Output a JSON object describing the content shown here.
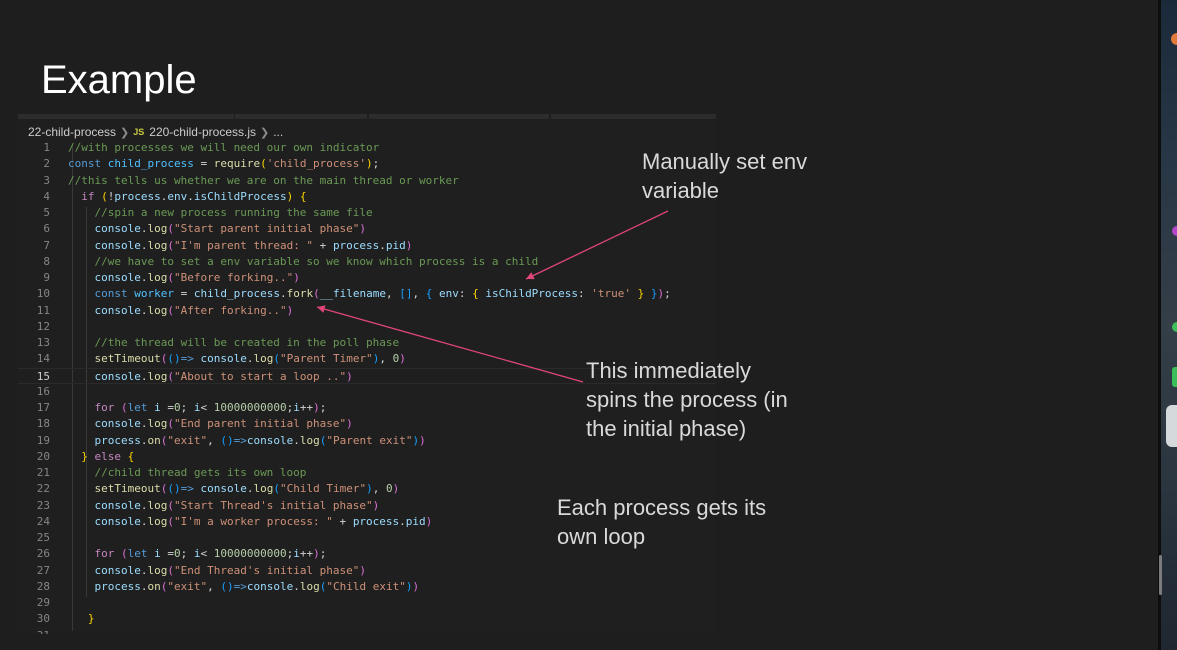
{
  "slide": {
    "title": "Example"
  },
  "breadcrumb": {
    "folder": "22-child-process",
    "file_icon": "JS",
    "file": "220-child-process.js",
    "more": "..."
  },
  "code": {
    "lines": [
      {
        "n": "1",
        "tokens": [
          [
            "com",
            "//with processes we will need our own indicator"
          ]
        ]
      },
      {
        "n": "2",
        "tokens": [
          [
            "kw",
            "const "
          ],
          [
            "const",
            "child_process"
          ],
          [
            "plain",
            " = "
          ],
          [
            "fn",
            "require"
          ],
          [
            "b1",
            "("
          ],
          [
            "str",
            "'child_process'"
          ],
          [
            "b1",
            ")"
          ],
          [
            "plain",
            ";"
          ]
        ]
      },
      {
        "n": "3",
        "tokens": [
          [
            "com",
            "//this tells us whether we are on the main thread or worker"
          ]
        ]
      },
      {
        "n": "4",
        "tokens": [
          [
            "plain",
            "  "
          ],
          [
            "ctl",
            "if "
          ],
          [
            "b1",
            "("
          ],
          [
            "plain",
            "!"
          ],
          [
            "var",
            "process"
          ],
          [
            "plain",
            "."
          ],
          [
            "var",
            "env"
          ],
          [
            "plain",
            "."
          ],
          [
            "var",
            "isChildProcess"
          ],
          [
            "b1",
            ")"
          ],
          [
            "plain",
            " "
          ],
          [
            "b1",
            "{"
          ]
        ]
      },
      {
        "n": "5",
        "tokens": [
          [
            "plain",
            "    "
          ],
          [
            "com",
            "//spin a new process running the same file"
          ]
        ]
      },
      {
        "n": "6",
        "tokens": [
          [
            "plain",
            "    "
          ],
          [
            "var",
            "console"
          ],
          [
            "plain",
            "."
          ],
          [
            "fn",
            "log"
          ],
          [
            "b2",
            "("
          ],
          [
            "str",
            "\"Start parent initial phase\""
          ],
          [
            "b2",
            ")"
          ]
        ]
      },
      {
        "n": "7",
        "tokens": [
          [
            "plain",
            "    "
          ],
          [
            "var",
            "console"
          ],
          [
            "plain",
            "."
          ],
          [
            "fn",
            "log"
          ],
          [
            "b2",
            "("
          ],
          [
            "str",
            "\"I'm parent thread: \""
          ],
          [
            "plain",
            " + "
          ],
          [
            "var",
            "process"
          ],
          [
            "plain",
            "."
          ],
          [
            "var",
            "pid"
          ],
          [
            "b2",
            ")"
          ]
        ]
      },
      {
        "n": "8",
        "tokens": [
          [
            "plain",
            "    "
          ],
          [
            "com",
            "//we have to set a env variable so we know which process is a child"
          ]
        ]
      },
      {
        "n": "9",
        "tokens": [
          [
            "plain",
            "    "
          ],
          [
            "var",
            "console"
          ],
          [
            "plain",
            "."
          ],
          [
            "fn",
            "log"
          ],
          [
            "b2",
            "("
          ],
          [
            "str",
            "\"Before forking..\""
          ],
          [
            "b2",
            ")"
          ]
        ]
      },
      {
        "n": "10",
        "tokens": [
          [
            "plain",
            "    "
          ],
          [
            "kw",
            "const "
          ],
          [
            "const",
            "worker"
          ],
          [
            "plain",
            " = "
          ],
          [
            "var",
            "child_process"
          ],
          [
            "plain",
            "."
          ],
          [
            "fn",
            "fork"
          ],
          [
            "b2",
            "("
          ],
          [
            "var",
            "__filename"
          ],
          [
            "plain",
            ", "
          ],
          [
            "b3",
            "[]"
          ],
          [
            "plain",
            ", "
          ],
          [
            "b3",
            "{"
          ],
          [
            "plain",
            " "
          ],
          [
            "var",
            "env"
          ],
          [
            "plain",
            ": "
          ],
          [
            "b1",
            "{"
          ],
          [
            "plain",
            " "
          ],
          [
            "var",
            "isChildProcess"
          ],
          [
            "plain",
            ": "
          ],
          [
            "str",
            "'true'"
          ],
          [
            "plain",
            " "
          ],
          [
            "b1",
            "}"
          ],
          [
            "plain",
            " "
          ],
          [
            "b3",
            "}"
          ],
          [
            "b2",
            ")"
          ],
          [
            "plain",
            ";"
          ]
        ]
      },
      {
        "n": "11",
        "tokens": [
          [
            "plain",
            "    "
          ],
          [
            "var",
            "console"
          ],
          [
            "plain",
            "."
          ],
          [
            "fn",
            "log"
          ],
          [
            "b2",
            "("
          ],
          [
            "str",
            "\"After forking..\""
          ],
          [
            "b2",
            ")"
          ]
        ]
      },
      {
        "n": "12",
        "tokens": []
      },
      {
        "n": "13",
        "tokens": [
          [
            "plain",
            "    "
          ],
          [
            "com",
            "//the thread will be created in the poll phase"
          ]
        ]
      },
      {
        "n": "14",
        "tokens": [
          [
            "plain",
            "    "
          ],
          [
            "fn",
            "setTimeout"
          ],
          [
            "b2",
            "("
          ],
          [
            "b3",
            "()"
          ],
          [
            "arrow",
            "=>"
          ],
          [
            "plain",
            " "
          ],
          [
            "var",
            "console"
          ],
          [
            "plain",
            "."
          ],
          [
            "fn",
            "log"
          ],
          [
            "b3",
            "("
          ],
          [
            "str",
            "\"Parent Timer\""
          ],
          [
            "b3",
            ")"
          ],
          [
            "plain",
            ", "
          ],
          [
            "num",
            "0"
          ],
          [
            "b2",
            ")"
          ]
        ]
      },
      {
        "n": "15",
        "tokens": [
          [
            "plain",
            "    "
          ],
          [
            "var",
            "console"
          ],
          [
            "plain",
            "."
          ],
          [
            "fn",
            "log"
          ],
          [
            "b2",
            "("
          ],
          [
            "str",
            "\"About to start a loop ..\""
          ],
          [
            "b2",
            ")"
          ]
        ]
      },
      {
        "n": "16",
        "tokens": []
      },
      {
        "n": "17",
        "tokens": [
          [
            "plain",
            "    "
          ],
          [
            "ctl",
            "for "
          ],
          [
            "b2",
            "("
          ],
          [
            "kw",
            "let "
          ],
          [
            "var",
            "i"
          ],
          [
            "plain",
            " ="
          ],
          [
            "num",
            "0"
          ],
          [
            "plain",
            "; "
          ],
          [
            "var",
            "i"
          ],
          [
            "plain",
            "< "
          ],
          [
            "num",
            "10000000000"
          ],
          [
            "plain",
            ";"
          ],
          [
            "var",
            "i"
          ],
          [
            "plain",
            "++"
          ],
          [
            "b2",
            ")"
          ],
          [
            "plain",
            ";"
          ]
        ]
      },
      {
        "n": "18",
        "tokens": [
          [
            "plain",
            "    "
          ],
          [
            "var",
            "console"
          ],
          [
            "plain",
            "."
          ],
          [
            "fn",
            "log"
          ],
          [
            "b2",
            "("
          ],
          [
            "str",
            "\"End parent initial phase\""
          ],
          [
            "b2",
            ")"
          ]
        ]
      },
      {
        "n": "19",
        "tokens": [
          [
            "plain",
            "    "
          ],
          [
            "var",
            "process"
          ],
          [
            "plain",
            "."
          ],
          [
            "fn",
            "on"
          ],
          [
            "b2",
            "("
          ],
          [
            "str",
            "\"exit\""
          ],
          [
            "plain",
            ", "
          ],
          [
            "b3",
            "()"
          ],
          [
            "arrow",
            "=>"
          ],
          [
            "var",
            "console"
          ],
          [
            "plain",
            "."
          ],
          [
            "fn",
            "log"
          ],
          [
            "b3",
            "("
          ],
          [
            "str",
            "\"Parent exit\""
          ],
          [
            "b3",
            ")"
          ],
          [
            "b2",
            ")"
          ]
        ]
      },
      {
        "n": "20",
        "tokens": [
          [
            "plain",
            "  "
          ],
          [
            "b1",
            "}"
          ],
          [
            "plain",
            " "
          ],
          [
            "ctl",
            "else"
          ],
          [
            "plain",
            " "
          ],
          [
            "b1",
            "{"
          ]
        ]
      },
      {
        "n": "21",
        "tokens": [
          [
            "plain",
            "    "
          ],
          [
            "com",
            "//child thread gets its own loop"
          ]
        ]
      },
      {
        "n": "22",
        "tokens": [
          [
            "plain",
            "    "
          ],
          [
            "fn",
            "setTimeout"
          ],
          [
            "b2",
            "("
          ],
          [
            "b3",
            "()"
          ],
          [
            "arrow",
            "=>"
          ],
          [
            "plain",
            " "
          ],
          [
            "var",
            "console"
          ],
          [
            "plain",
            "."
          ],
          [
            "fn",
            "log"
          ],
          [
            "b3",
            "("
          ],
          [
            "str",
            "\"Child Timer\""
          ],
          [
            "b3",
            ")"
          ],
          [
            "plain",
            ", "
          ],
          [
            "num",
            "0"
          ],
          [
            "b2",
            ")"
          ]
        ]
      },
      {
        "n": "23",
        "tokens": [
          [
            "plain",
            "    "
          ],
          [
            "var",
            "console"
          ],
          [
            "plain",
            "."
          ],
          [
            "fn",
            "log"
          ],
          [
            "b2",
            "("
          ],
          [
            "str",
            "\"Start Thread's initial phase\""
          ],
          [
            "b2",
            ")"
          ]
        ]
      },
      {
        "n": "24",
        "tokens": [
          [
            "plain",
            "    "
          ],
          [
            "var",
            "console"
          ],
          [
            "plain",
            "."
          ],
          [
            "fn",
            "log"
          ],
          [
            "b2",
            "("
          ],
          [
            "str",
            "\"I'm a worker process: \""
          ],
          [
            "plain",
            " + "
          ],
          [
            "var",
            "process"
          ],
          [
            "plain",
            "."
          ],
          [
            "var",
            "pid"
          ],
          [
            "b2",
            ")"
          ]
        ]
      },
      {
        "n": "25",
        "tokens": []
      },
      {
        "n": "26",
        "tokens": [
          [
            "plain",
            "    "
          ],
          [
            "ctl",
            "for "
          ],
          [
            "b2",
            "("
          ],
          [
            "kw",
            "let "
          ],
          [
            "var",
            "i"
          ],
          [
            "plain",
            " ="
          ],
          [
            "num",
            "0"
          ],
          [
            "plain",
            "; "
          ],
          [
            "var",
            "i"
          ],
          [
            "plain",
            "< "
          ],
          [
            "num",
            "10000000000"
          ],
          [
            "plain",
            ";"
          ],
          [
            "var",
            "i"
          ],
          [
            "plain",
            "++"
          ],
          [
            "b2",
            ")"
          ],
          [
            "plain",
            ";"
          ]
        ]
      },
      {
        "n": "27",
        "tokens": [
          [
            "plain",
            "    "
          ],
          [
            "var",
            "console"
          ],
          [
            "plain",
            "."
          ],
          [
            "fn",
            "log"
          ],
          [
            "b2",
            "("
          ],
          [
            "str",
            "\"End Thread's initial phase\""
          ],
          [
            "b2",
            ")"
          ]
        ]
      },
      {
        "n": "28",
        "tokens": [
          [
            "plain",
            "    "
          ],
          [
            "var",
            "process"
          ],
          [
            "plain",
            "."
          ],
          [
            "fn",
            "on"
          ],
          [
            "b2",
            "("
          ],
          [
            "str",
            "\"exit\""
          ],
          [
            "plain",
            ", "
          ],
          [
            "b3",
            "()"
          ],
          [
            "arrow",
            "=>"
          ],
          [
            "var",
            "console"
          ],
          [
            "plain",
            "."
          ],
          [
            "fn",
            "log"
          ],
          [
            "b3",
            "("
          ],
          [
            "str",
            "\"Child exit\""
          ],
          [
            "b3",
            ")"
          ],
          [
            "b2",
            ")"
          ]
        ]
      },
      {
        "n": "29",
        "tokens": []
      },
      {
        "n": "30",
        "tokens": [
          [
            "plain",
            "   "
          ],
          [
            "b1",
            "}"
          ]
        ]
      },
      {
        "n": "31",
        "tokens": []
      }
    ],
    "current_line": "15"
  },
  "annotations": {
    "note1_line1": "Manually set env",
    "note1_line2": "variable",
    "note2_line1": "This immediately",
    "note2_line2": "spins the process (in",
    "note2_line3": "the initial phase)",
    "note3_line1": "Each process gets its",
    "note3_line2": "own loop"
  },
  "colors": {
    "arrow": "#e0457b",
    "background": "#1e1e1e",
    "editor": "#1f1f1f"
  }
}
